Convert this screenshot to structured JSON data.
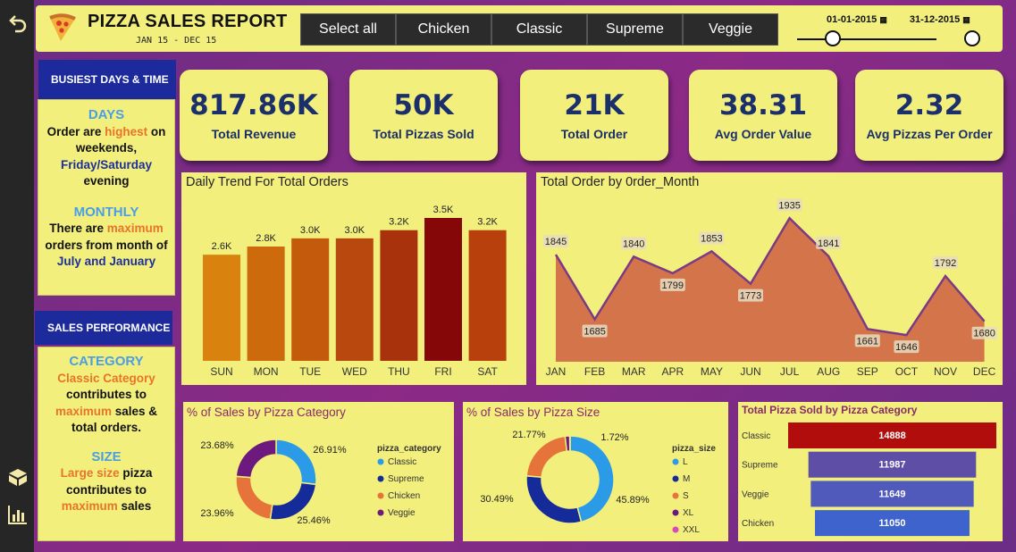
{
  "header": {
    "title": "PIZZA SALES REPORT",
    "subtitle": "JAN 15 - DEC 15",
    "slicer": [
      "Select all",
      "Chicken",
      "Classic",
      "Supreme",
      "Veggie"
    ],
    "date_start": "01-01-2015",
    "date_end": "31-12-2015"
  },
  "sidebar": {
    "busiest_heading": "BUSIEST DAYS & TIME",
    "days_title": "DAYS",
    "days_p1": "Order are",
    "days_highest": "highest",
    "days_p2": "on weekends,",
    "days_p3": "Friday/Saturday",
    "days_p4": "evening",
    "monthly_title": "MONTHLY",
    "monthly_p1": "There are",
    "monthly_max": "maximum",
    "monthly_p2": "orders from month of",
    "monthly_p3": "July and January",
    "sales_heading": "SALES PERFORMANCE",
    "category_title": "CATEGORY",
    "cat_p1": "Classic Category",
    "cat_p2": "contributes to",
    "cat_max": "maximum",
    "cat_p3": "sales &",
    "cat_p4": "total orders.",
    "size_title": "SIZE",
    "size_p1": "Large size",
    "size_p2": "pizza",
    "size_p3": "contributes to",
    "size_max": "maximum",
    "size_p4": "sales"
  },
  "kpis": [
    {
      "value": "817.86K",
      "label": "Total Revenue"
    },
    {
      "value": "50K",
      "label": "Total Pizzas Sold"
    },
    {
      "value": "21K",
      "label": "Total Order"
    },
    {
      "value": "38.31",
      "label": "Avg Order Value"
    },
    {
      "value": "2.32",
      "label": "Avg Pizzas Per Order"
    }
  ],
  "colors": {
    "panel": "#f2ef7d",
    "navy": "#1c2a9c",
    "area": "#d4744a",
    "area_line": "#7b3a86"
  },
  "chart_data": [
    {
      "type": "bar",
      "title": "Daily Trend For Total Orders",
      "categories": [
        "SUN",
        "MON",
        "TUE",
        "WED",
        "THU",
        "FRI",
        "SAT"
      ],
      "values": [
        2.6,
        2.8,
        3.0,
        3.0,
        3.2,
        3.5,
        3.2
      ],
      "labels": [
        "2.6K",
        "2.8K",
        "3.0K",
        "3.0K",
        "3.2K",
        "3.5K",
        "3.2K"
      ],
      "colors": [
        "#d9820e",
        "#cc6a0c",
        "#c35a0c",
        "#b8480d",
        "#a8320b",
        "#850707",
        "#b8400d"
      ]
    },
    {
      "type": "area",
      "title": "Total Order by 0rder_Month",
      "categories": [
        "JAN",
        "FEB",
        "MAR",
        "APR",
        "MAY",
        "JUN",
        "JUL",
        "AUG",
        "SEP",
        "OCT",
        "NOV",
        "DEC"
      ],
      "values": [
        1845,
        1685,
        1840,
        1799,
        1853,
        1773,
        1935,
        1841,
        1661,
        1646,
        1792,
        1680
      ]
    },
    {
      "type": "pie",
      "title": "% of Sales by Pizza Category",
      "legend_title": "pizza_category",
      "labels": [
        "Classic",
        "Supreme",
        "Chicken",
        "Veggie"
      ],
      "values": [
        26.91,
        25.46,
        23.96,
        23.68
      ],
      "value_labels": [
        "26.91%",
        "25.46%",
        "23.96%",
        "23.68%"
      ],
      "colors": [
        "#2b9be8",
        "#152b9a",
        "#e5733a",
        "#6d1a7f"
      ]
    },
    {
      "type": "pie",
      "title": "% of Sales by Pizza Size",
      "legend_title": "pizza_size",
      "labels": [
        "L",
        "M",
        "S",
        "XL",
        "XXL"
      ],
      "values": [
        45.89,
        30.49,
        21.77,
        1.72,
        0.12
      ],
      "value_labels": [
        "45.89%",
        "30.49%",
        "21.77%",
        "1.72%"
      ],
      "colors": [
        "#2b9be8",
        "#152b9a",
        "#e5733a",
        "#6d1a7f",
        "#d84ab5"
      ]
    },
    {
      "type": "bar",
      "title": "Total Pizza Sold by Pizza Category",
      "categories": [
        "Classic",
        "Supreme",
        "Veggie",
        "Chicken"
      ],
      "values": [
        14888,
        11987,
        11649,
        11050
      ],
      "colors": [
        "#b10d0d",
        "#5e4ea6",
        "#4f5abb",
        "#3f63cc"
      ]
    }
  ]
}
